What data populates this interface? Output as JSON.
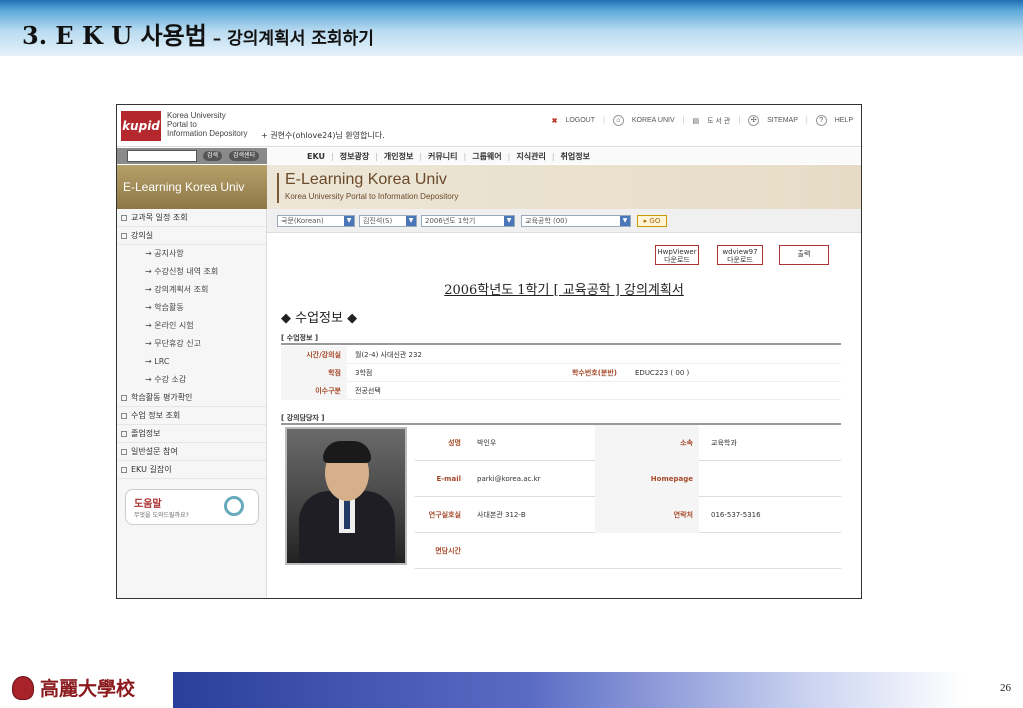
{
  "slide": {
    "title_main": "3. E K U 사용법",
    "title_sub": " – 강의계획서 조회하기",
    "page_number": "26",
    "university_name": "高麗大學校"
  },
  "portal": {
    "logo_text": "kupid",
    "logo_caption": [
      "Korea University",
      "Portal to",
      "Information Depository"
    ],
    "welcome": "+ 권현수(ohlove24)님 환영합니다.",
    "top_links": [
      "LOGOUT",
      "KOREA UNIV",
      "도 서 관",
      "SITEMAP",
      "HELP"
    ],
    "search_buttons": [
      "검색",
      "검색센터"
    ],
    "menu": [
      "EKU",
      "정보광장",
      "개인정보",
      "커뮤니티",
      "그룹웨어",
      "지식관리",
      "취업정보"
    ],
    "brand_left": "E-Learning Korea Univ",
    "brand_title": "E-Learning Korea Univ",
    "brand_subtitle": "Korea University Portal to Information Depository"
  },
  "sidebar": {
    "items": [
      {
        "label": "교과목 일정 조회",
        "sub": false
      },
      {
        "label": "강의실",
        "sub": false
      },
      {
        "label": "→ 공지사항",
        "sub": true
      },
      {
        "label": "→ 수강신청 내역 조회",
        "sub": true
      },
      {
        "label": "→ 강의계획서 조회",
        "sub": true
      },
      {
        "label": "→ 학습활동",
        "sub": true
      },
      {
        "label": "→ 온라인 시험",
        "sub": true
      },
      {
        "label": "→ 무단휴강 신고",
        "sub": true
      },
      {
        "label": "→ LRC",
        "sub": true
      },
      {
        "label": "→ 수강 소감",
        "sub": true
      },
      {
        "label": "학습활동 평가확인",
        "sub": false
      },
      {
        "label": "수업 정보 조회",
        "sub": false
      },
      {
        "label": "졸업정보",
        "sub": false
      },
      {
        "label": "일반설문 참여",
        "sub": false
      },
      {
        "label": "EKU 길잡이",
        "sub": false
      }
    ],
    "helpdesk_title": "도움말",
    "helpdesk_sub": "무엇을 도와드릴까요?"
  },
  "filters": {
    "language": "국문(Korean)",
    "professor": "김진석(S)",
    "term": "2006년도 1학기",
    "course": "교육공학 (00)",
    "go_label": "GO"
  },
  "buttons": {
    "hwp": [
      "HwpViewer",
      "다운로드"
    ],
    "wd": [
      "wdview97",
      "다운로드"
    ],
    "print": "출력"
  },
  "plan": {
    "title": "2006학년도 1학기 [ 교육공학 ] 강의계획서",
    "section_title": "◆ 수업정보 ◆",
    "info_label": "[ 수업정보 ]",
    "rows": {
      "time_label": "시간/강의실",
      "time_value": "월(2-4) 사대신관 232",
      "credit_label": "학점",
      "credit_value": "3학점",
      "course_no_label": "학수번호(분반)",
      "course_no_value": "EDUC223 ( 00 )",
      "type_label": "이수구분",
      "type_value": "전공선택"
    },
    "instructor_label": "[ 강의담당자 ]",
    "instructor": {
      "name_label": "성명",
      "name_value": "박인우",
      "dept_label": "소속",
      "dept_value": "교육학과",
      "email_label": "E-mail",
      "email_value": "parki@korea.ac.kr",
      "homepage_label": "Homepage",
      "homepage_value": "",
      "lab_label": "연구실호실",
      "lab_value": "사대본관 312-B",
      "contact_label": "연락처",
      "contact_value": "016-537-5316",
      "hours_label": "면담시간",
      "hours_value": ""
    }
  }
}
